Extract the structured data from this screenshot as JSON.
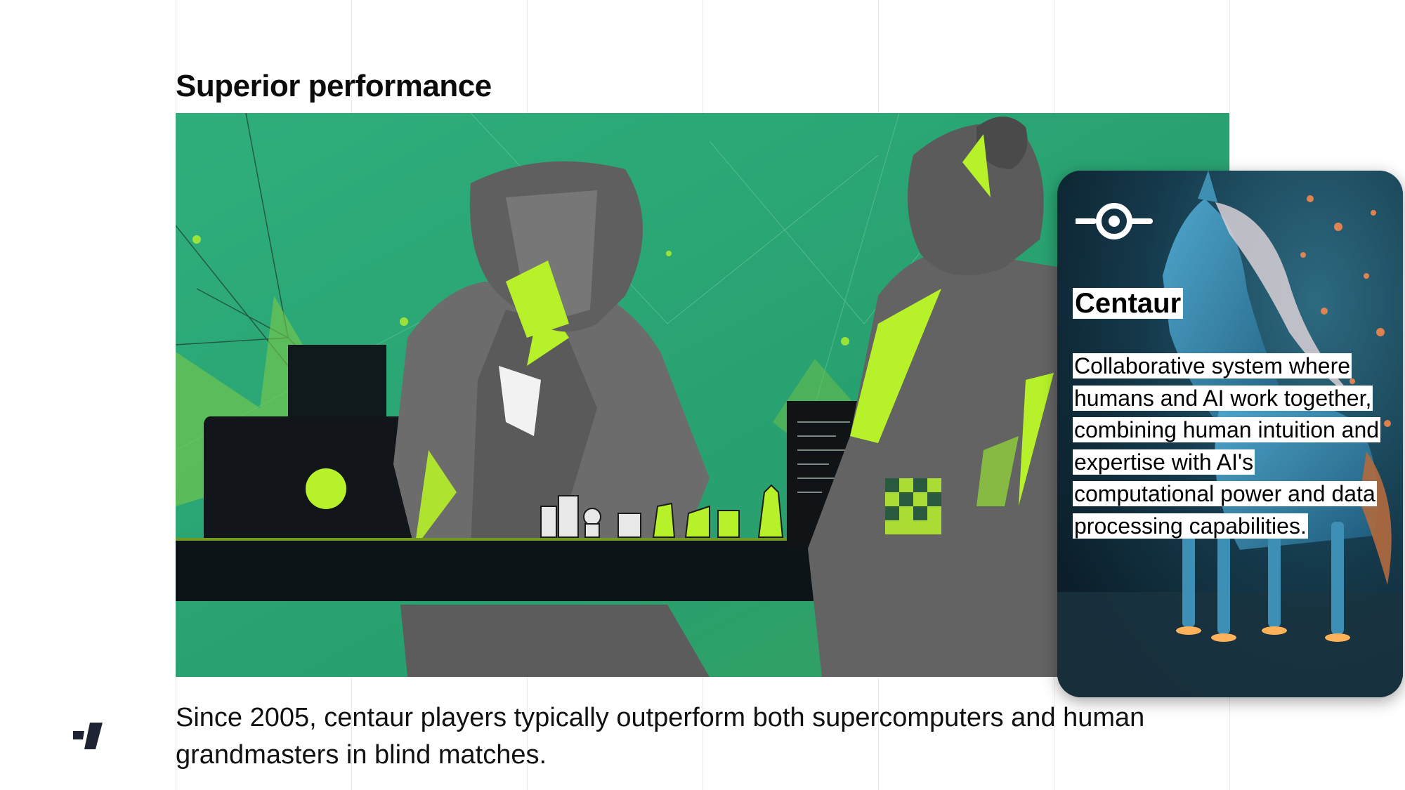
{
  "page": {
    "title": "Superior performance",
    "caption": "Since 2005, centaur players typically outperform both supercomputers and human grandmasters in blind matches."
  },
  "illustration": {
    "icon": "chess-players-illustration"
  },
  "card": {
    "icon": "centaur-logo-icon",
    "title": "Centaur",
    "description": "Collaborative system where humans and AI work together, combining human intuition and expertise with AI's computational power and data processing capabilities."
  },
  "brand": {
    "icon": "brand-logo-icon"
  },
  "colors": {
    "accent_green": "#b6f12a",
    "background_green": "#2fa878",
    "dark": "#0b0f12",
    "card_background": "#0f2a38"
  }
}
